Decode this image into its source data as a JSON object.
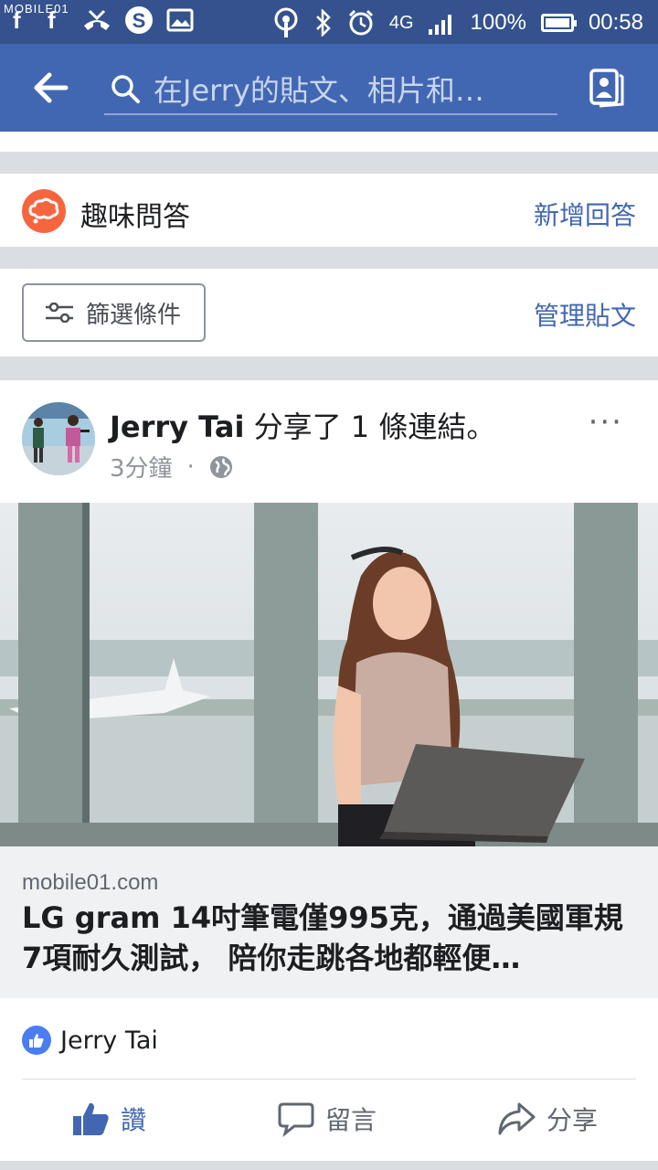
{
  "status_bar": {
    "watermark": "MOBILE01",
    "network": "4G",
    "battery": "100%",
    "time": "00:58"
  },
  "navbar": {
    "search_placeholder": "在Jerry的貼文、相片和…"
  },
  "qa": {
    "label": "趣味問答",
    "add_answer": "新增回答"
  },
  "filter": {
    "label": "篩選條件",
    "manage": "管理貼文"
  },
  "post": {
    "author": "Jerry Tai",
    "action_text": " 分享了 1 條連結。",
    "time": "3分鐘",
    "separator": "·",
    "more": "···",
    "link": {
      "domain": "mobile01.com",
      "title": "LG gram 14吋筆電僅995克，通過美國軍規7項耐久測試， 陪你走跳各地都輕便…"
    },
    "liked_by": "Jerry Tai",
    "actions": {
      "like": "讚",
      "comment": "留言",
      "share": "分享"
    }
  },
  "colors": {
    "statusbar": "#35528f",
    "navbar": "#4267b2",
    "accent": "#4267b2",
    "qa_icon": "#f5663f"
  }
}
